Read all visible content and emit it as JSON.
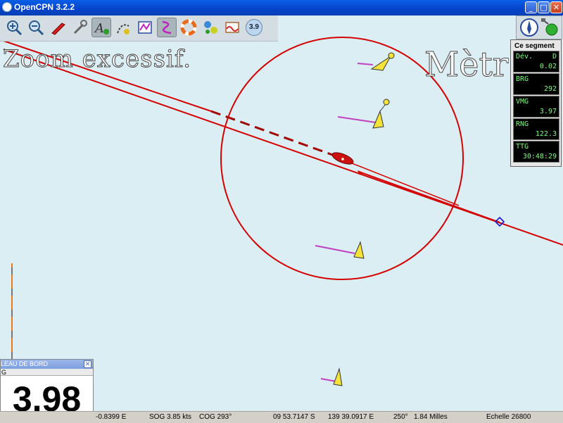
{
  "window": {
    "title": "OpenCPN 3.2.2",
    "controls": {
      "minimize": "_",
      "maximize": "□",
      "close": "✕"
    }
  },
  "toolbar": {
    "buttons": [
      {
        "name": "zoom-in",
        "icon": "zoom-in-icon",
        "active": false
      },
      {
        "name": "zoom-out",
        "icon": "zoom-out-icon",
        "active": false
      },
      {
        "name": "center-ship",
        "icon": "ship-icon",
        "active": false
      },
      {
        "name": "settings",
        "icon": "wrench-icon",
        "active": false
      },
      {
        "name": "text-tool",
        "icon": "text-add-icon",
        "active": true
      },
      {
        "name": "route",
        "icon": "route-icon",
        "active": false
      },
      {
        "name": "route-manager",
        "icon": "route-manager-icon",
        "active": false
      },
      {
        "name": "track",
        "icon": "track-icon",
        "active": true
      },
      {
        "name": "mob",
        "icon": "lifebuoy-icon",
        "active": false
      },
      {
        "name": "ais",
        "icon": "ais-icon",
        "active": false
      },
      {
        "name": "tides",
        "icon": "tide-icon",
        "active": false
      }
    ],
    "version_badge": "3.9"
  },
  "chart_overlay": {
    "zoom_warning": "Zoom excessif.",
    "unit_text": "Mètr"
  },
  "segment_panel": {
    "title": "Ce segment",
    "items": [
      {
        "label": "Dév.",
        "unit": "D",
        "value": "0.02"
      },
      {
        "label": "BRG",
        "unit": "",
        "value": "292"
      },
      {
        "label": "VMG",
        "unit": "",
        "value": "3.97"
      },
      {
        "label": "RNG",
        "unit": "",
        "value": "122.3"
      },
      {
        "label": "TTG",
        "unit": "",
        "value": "30:48:29"
      }
    ]
  },
  "dashboard": {
    "title": "LEAU DE BORD",
    "sublabel": "G",
    "value": "3.98"
  },
  "statusbar": {
    "lon": "-0.8399 E",
    "sog": "SOG 3.85 kts",
    "cog": "COG 293°",
    "cursor_lat": "09 53.7147 S",
    "cursor_lon": "139 39.0917 E",
    "bearing": "250°",
    "distance": "1.84 Milles",
    "scale": "Echelle 26800"
  },
  "colors": {
    "sea": "#dbeef3",
    "route": "#d40000",
    "ais_target": "#f5e23a",
    "ais_trail": "#c040c0",
    "instrument_text": "#7cff7c"
  }
}
